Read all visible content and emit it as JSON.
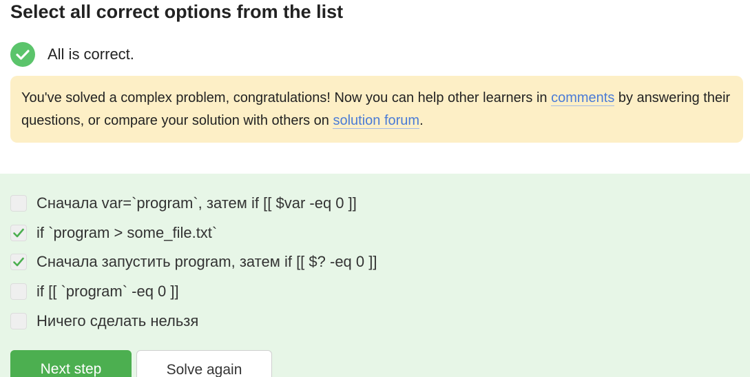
{
  "quiz": {
    "title": "Select all correct options from the list"
  },
  "result": {
    "text": "All is correct.",
    "icon": "check-circle-icon",
    "color": "#5bc46b"
  },
  "notice": {
    "before_comments": "You've solved a complex problem, congratulations! Now you can help other learners in ",
    "comments_link": "comments",
    "middle": " by answering their questions, or compare your solution with others on ",
    "forum_link": "solution forum",
    "after": ".",
    "background": "#fdefc6",
    "link_color": "#4a7bd6"
  },
  "options": [
    {
      "label": "Сначала var=`program`, затем if [[ $var -eq 0 ]]",
      "checked": false
    },
    {
      "label": "if `program > some_file.txt`",
      "checked": true
    },
    {
      "label": "Сначала запустить program, затем if [[ $? -eq 0 ]]",
      "checked": true
    },
    {
      "label": "if [[ `program` -eq 0 ]]",
      "checked": false
    },
    {
      "label": "Ничего сделать нельзя",
      "checked": false
    }
  ],
  "buttons": {
    "next": "Next step",
    "solve_again": "Solve again"
  },
  "colors": {
    "options_background": "#e7f6e7",
    "primary_button": "#4caf50"
  }
}
